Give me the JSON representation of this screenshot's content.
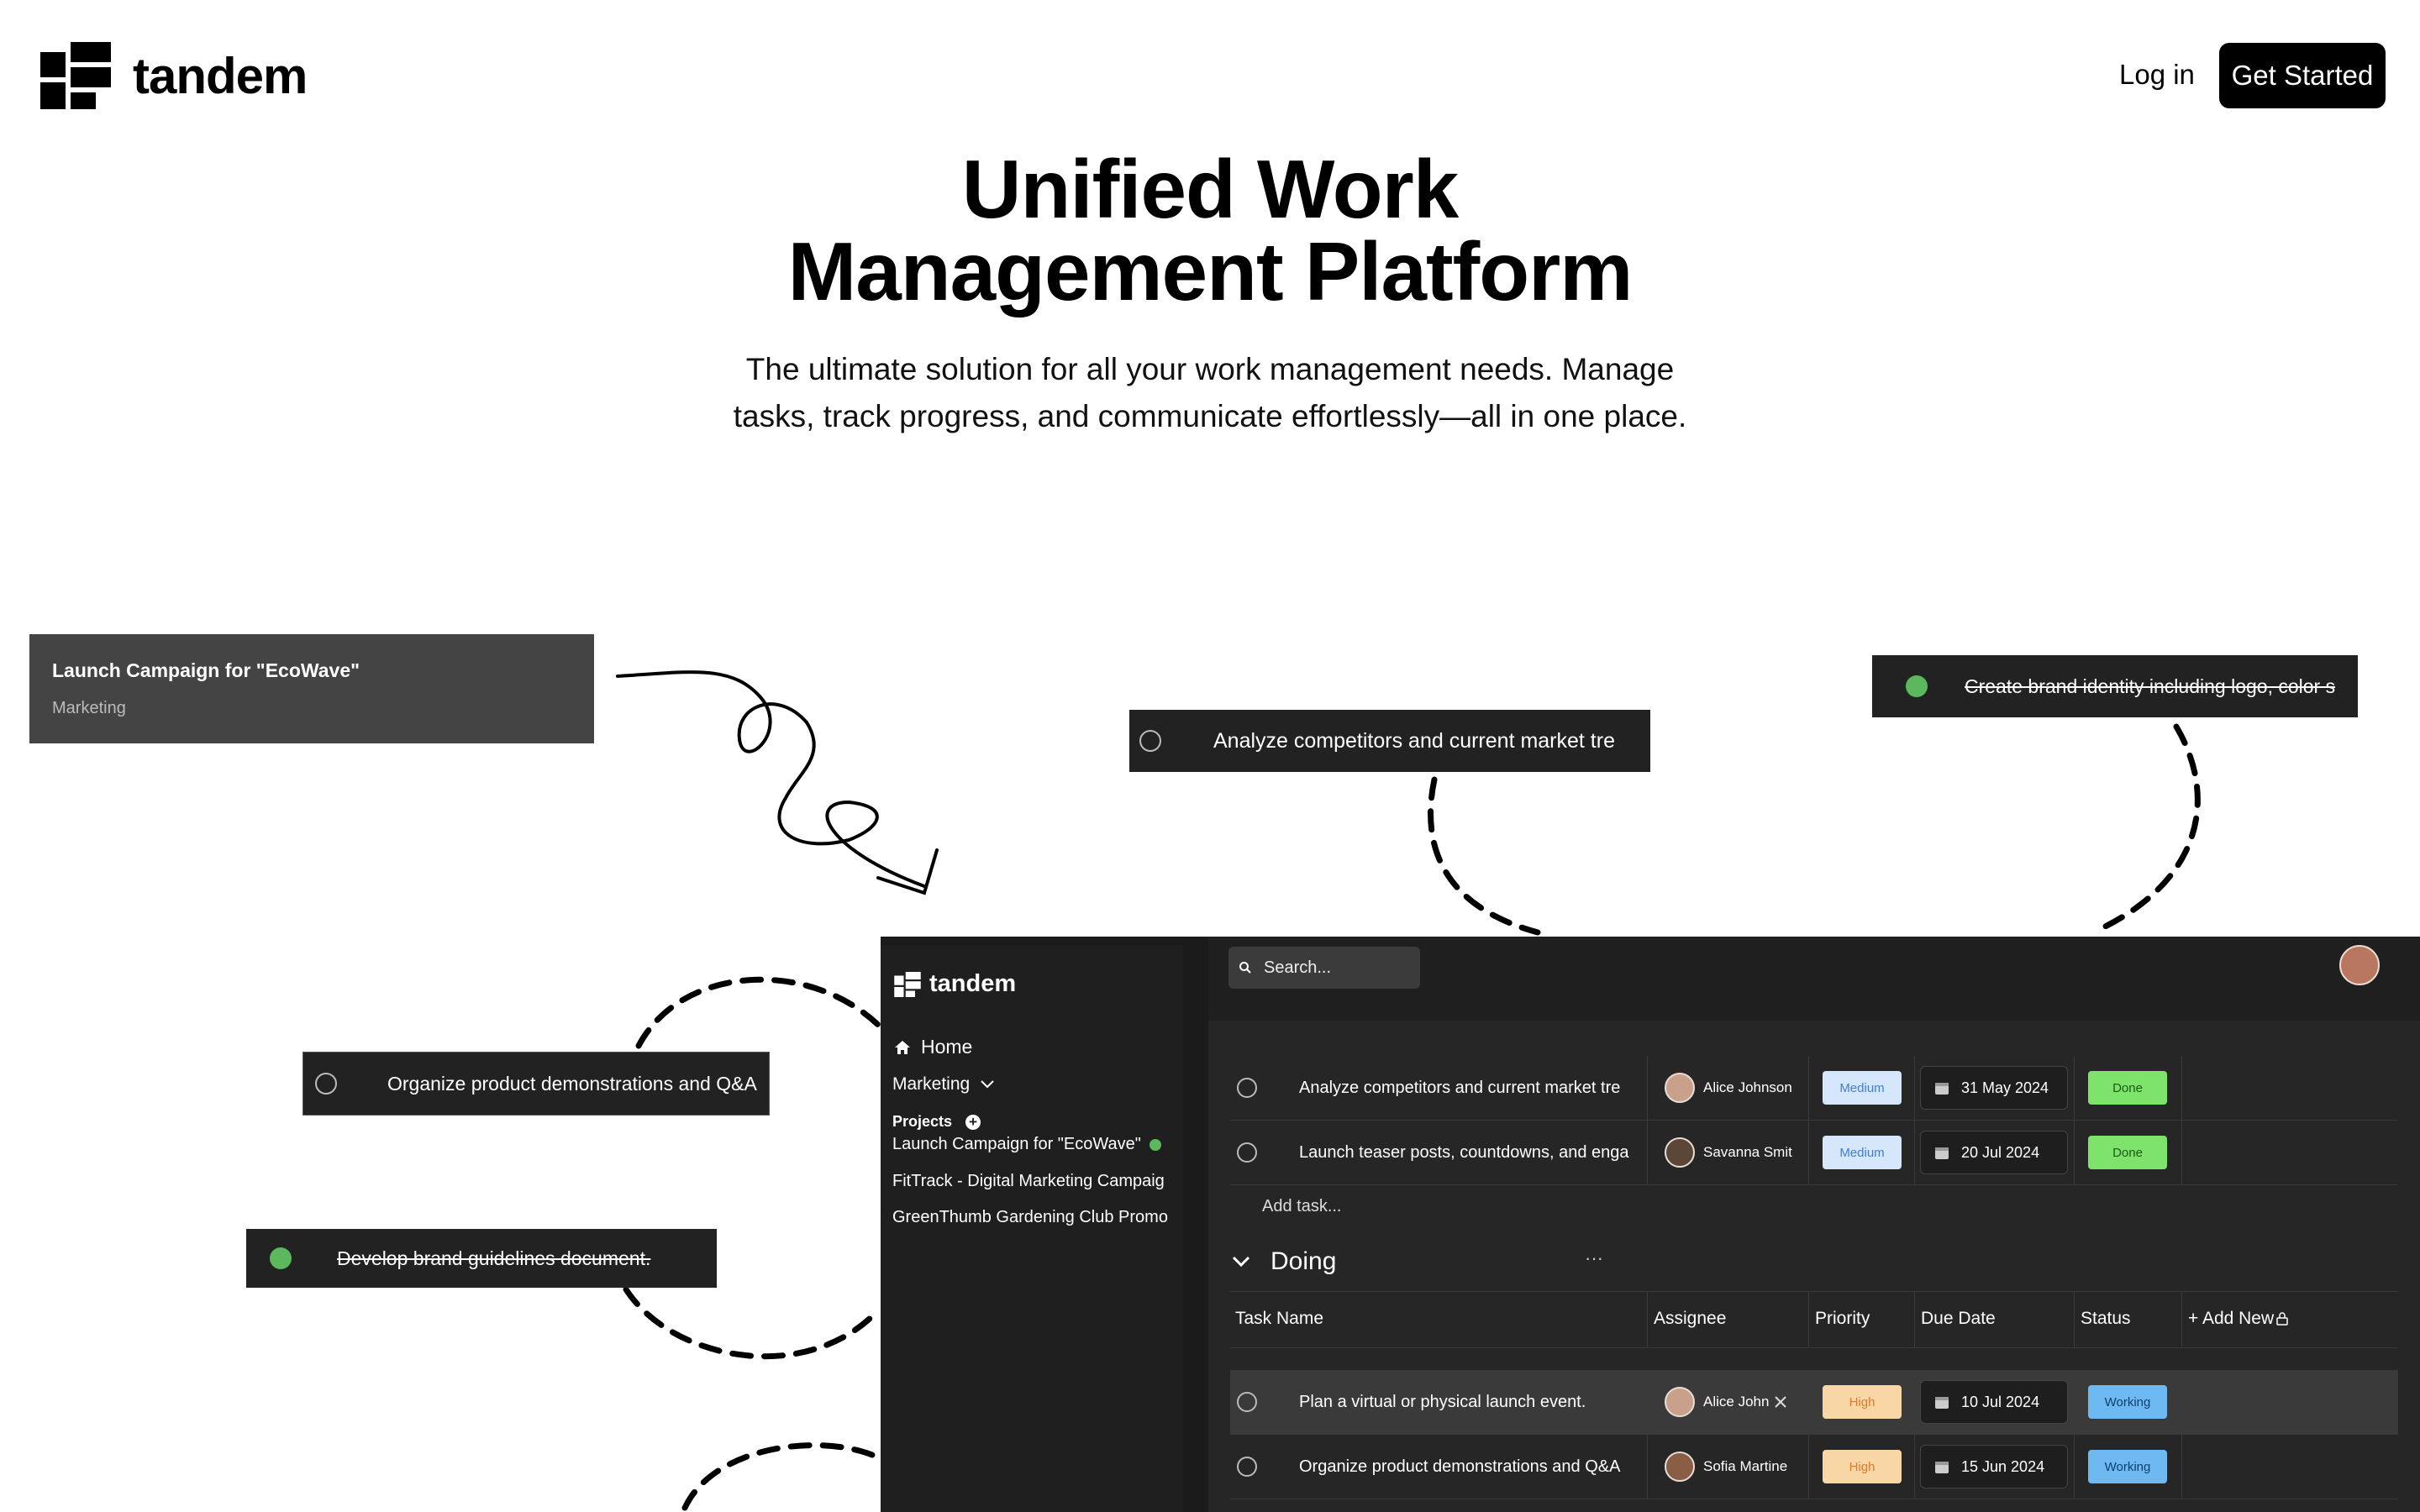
{
  "header": {
    "brand": "tandem",
    "login": "Log in",
    "get_started": "Get Started"
  },
  "hero": {
    "title_line1": "Unified Work",
    "title_line2": "Management Platform",
    "subtitle_line1": "The ultimate solution for all your work management needs. Manage",
    "subtitle_line2": "tasks, track progress, and communicate effortlessly—all in one place."
  },
  "floating": {
    "eco_title": "Launch Campaign for \"EcoWave\"",
    "eco_sub": "Marketing",
    "analyze": "Analyze competitors and current market tre",
    "brand_identity": "Create brand identity including logo, color s",
    "organize": "Organize product demonstrations and Q&A",
    "guidelines": "Develop brand guidelines document."
  },
  "app": {
    "brand": "tandem",
    "search_placeholder": "Search...",
    "nav_home": "Home",
    "nav_workspace": "Marketing",
    "projects_label": "Projects",
    "projects": [
      "Launch Campaign for \"EcoWave\"",
      "FitTrack - Digital Marketing Campaig",
      "GreenThumb Gardening Club Promo"
    ],
    "done_rows": [
      {
        "task": "Analyze competitors and current market tre",
        "assignee": "Alice Johnson",
        "priority": "Medium",
        "due": "31 May 2024",
        "status": "Done"
      },
      {
        "task": "Launch teaser posts, countdowns, and enga",
        "assignee": "Savanna Smit",
        "priority": "Medium",
        "due": "20 Jul 2024",
        "status": "Done"
      }
    ],
    "add_task": "Add task...",
    "section": "Doing",
    "more": "···",
    "columns": {
      "task": "Task Name",
      "assignee": "Assignee",
      "priority": "Priority",
      "due": "Due Date",
      "status": "Status",
      "add": "+ Add New"
    },
    "doing_rows": [
      {
        "task": "Plan a virtual or physical launch event.",
        "assignee": "Alice John",
        "priority": "High",
        "due": "10 Jul 2024",
        "status": "Working"
      },
      {
        "task": "Organize product demonstrations and Q&A",
        "assignee": "Sofia Martine",
        "priority": "High",
        "due": "15 Jun 2024",
        "status": "Working"
      }
    ]
  },
  "colors": {
    "medium_bg": "#d6e6fb",
    "medium_fg": "#3f7fd1",
    "high_bg": "#f8d6a6",
    "high_fg": "#e07a2a",
    "done_bg": "#7ee36b",
    "done_fg": "#1c5a14",
    "working_bg": "#6fb9f3",
    "working_fg": "#0e3f6e",
    "project_dot": "#5cb85c"
  }
}
